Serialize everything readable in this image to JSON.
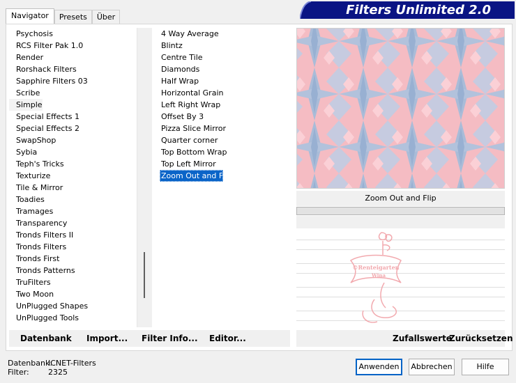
{
  "tabs": [
    {
      "label": "Navigator",
      "active": true
    },
    {
      "label": "Presets",
      "active": false
    },
    {
      "label": "Über",
      "active": false
    }
  ],
  "banner": {
    "title": "Filters Unlimited 2.0",
    "color": "#0a1484"
  },
  "categories": {
    "items": [
      "Psychosis",
      "RCS Filter Pak 1.0",
      "Render",
      "Rorshack Filters",
      "Sapphire Filters 03",
      "Scribe",
      "Simple",
      "Special Effects 1",
      "Special Effects 2",
      "SwapShop",
      "Sybia",
      "Teph's Tricks",
      "Texturize",
      "Tile & Mirror",
      "Toadies",
      "Tramages",
      "Transparency",
      "Tronds Filters II",
      "Tronds Filters",
      "Tronds First",
      "Tronds Patterns",
      "TruFilters",
      "Two Moon",
      "UnPlugged Shapes",
      "UnPlugged Tools"
    ],
    "hovered": "Simple"
  },
  "filters": {
    "items": [
      "4 Way Average",
      "Blintz",
      "Centre Tile",
      "Diamonds",
      "Half Wrap",
      "Horizontal Grain",
      "Left Right Wrap",
      "Offset By 3",
      "Pizza Slice Mirror",
      "Quarter corner",
      "Top Bottom Wrap",
      "Top Left Mirror",
      "Zoom Out and Flip"
    ],
    "selected": "Zoom Out and Flip",
    "selection_color": "#0a64c8"
  },
  "preview": {
    "label": "Zoom Out and Flip",
    "colors": [
      "#f5bcc3",
      "#a4b8d6"
    ]
  },
  "toolbar": {
    "datenbank": "Datenbank",
    "import": "Import...",
    "filter_info": "Filter Info...",
    "editor": "Editor..."
  },
  "toolbar_right": {
    "zufallswerte": "Zufallswerte",
    "zuruecksetzen": "Zurücksetzen"
  },
  "status": {
    "database_label": "Datenbank:",
    "database_value": "ICNET-Filters",
    "filter_label": "Filter:",
    "filter_value": "2325"
  },
  "buttons": {
    "apply": "Anwenden",
    "cancel": "Abbrechen",
    "help": "Hilfe"
  },
  "watermark": {
    "text1": "©Renteigarten",
    "text2": "Wina",
    "color": "#f2a9ae"
  }
}
